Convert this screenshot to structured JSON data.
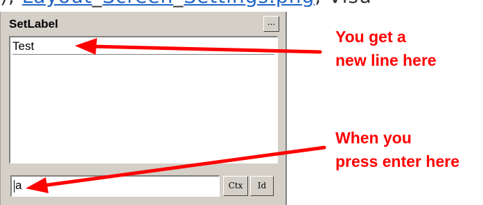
{
  "header_link": {
    "text_segments": [
      {
        "text": "), ",
        "link": false
      },
      {
        "text": "Layout",
        "link": true
      },
      {
        "text": "_",
        "link": false
      },
      {
        "text": "Screen",
        "link": true
      },
      {
        "text": "_",
        "link": false
      },
      {
        "text": "Settings",
        "link": true
      },
      {
        "text": ".png",
        "link": true
      },
      {
        "text": ", Visu",
        "link": false
      }
    ]
  },
  "panel": {
    "title": "SetLabel",
    "menu_button_label": "...",
    "list_lines": [
      "Test"
    ],
    "input_value": "a",
    "ctx_button_label": "Ctx",
    "id_button_label": "Id"
  },
  "annotations": {
    "top": {
      "lines": [
        "You get a",
        "new line here"
      ]
    },
    "bottom": {
      "lines": [
        "When you",
        "press enter here"
      ]
    }
  },
  "colors": {
    "panel_bg": "#d4d0c8",
    "annotation": "#ff0000",
    "link": "#1f63c6"
  }
}
